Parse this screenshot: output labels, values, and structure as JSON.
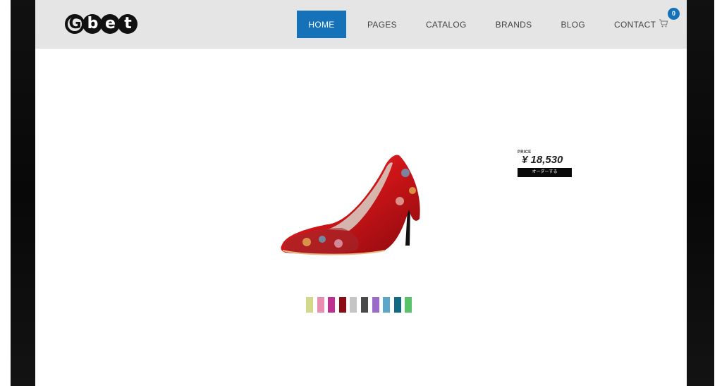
{
  "logo": {
    "text": "Gbet",
    "letters": [
      "G",
      "b",
      "e",
      "t"
    ]
  },
  "nav": {
    "items": [
      {
        "label": "HOME",
        "active": true
      },
      {
        "label": "PAGES",
        "active": false
      },
      {
        "label": "CATALOG",
        "active": false
      },
      {
        "label": "BRANDS",
        "active": false
      },
      {
        "label": "BLOG",
        "active": false
      },
      {
        "label": "CONTACT",
        "active": false
      }
    ],
    "cart_icon": "shopping-cart-icon",
    "cart_count": "0"
  },
  "product": {
    "image": "red-embroidered-stiletto-pump",
    "price_label": "PRICE",
    "price": "¥ 18,530",
    "order_label": "オーダーする"
  },
  "swatches": {
    "colors": [
      "#d4d98a",
      "#e88fb0",
      "#c12f93",
      "#8e0a14",
      "#c5c5c5",
      "#4a4a4a",
      "#9a6bc8",
      "#5aa8c9",
      "#0f6a84",
      "#5ac36a"
    ]
  },
  "theme": {
    "accent": "#1572b8",
    "navbar_bg": "#e5e5e5"
  }
}
